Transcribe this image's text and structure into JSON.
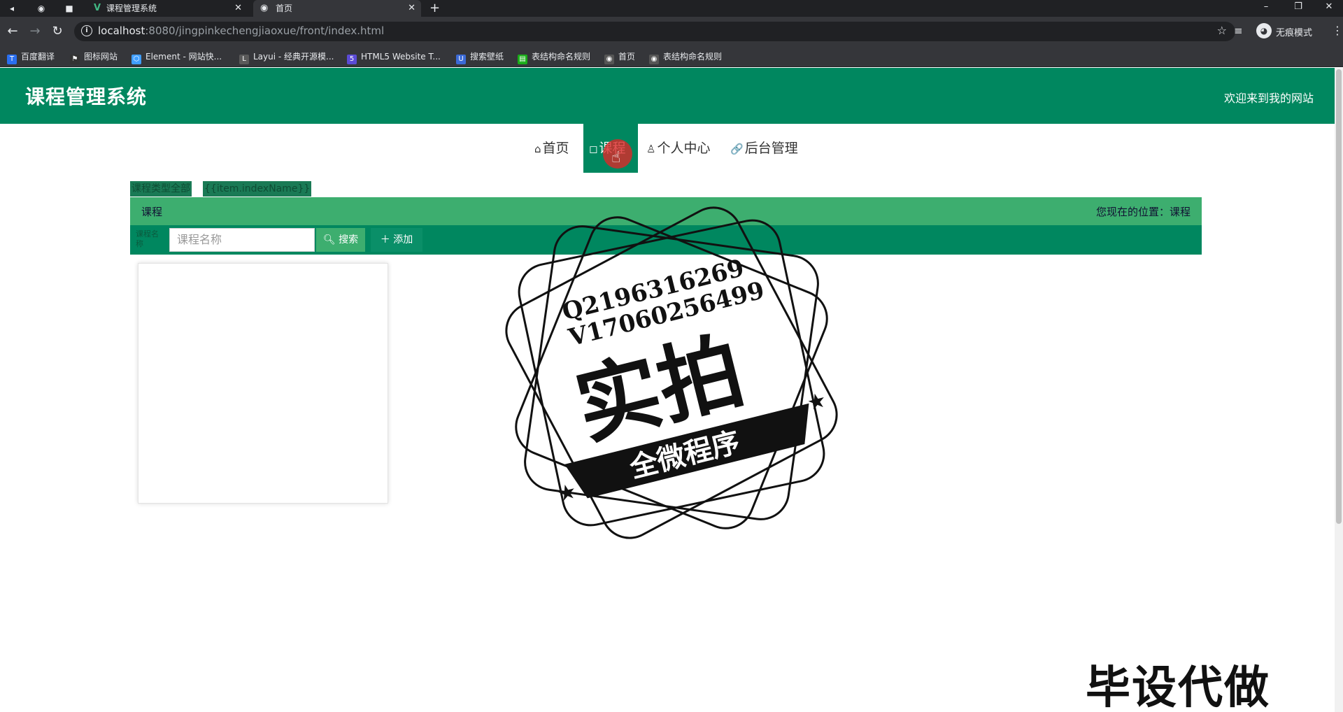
{
  "browser": {
    "tabs": [
      {
        "title": "课程管理系统",
        "active": false,
        "favicon": "vue-logo-icon"
      },
      {
        "title": "首页",
        "active": true,
        "favicon": "globe-icon"
      }
    ],
    "url_host": "localhost",
    "url_rest": ":8080/jingpinkechengjiaoxue/front/index.html",
    "profile_label": "无痕模式",
    "bookmarks": [
      {
        "label": "百度翻译",
        "color": "#2a6ff0"
      },
      {
        "label": "图标网站",
        "color": "#333333"
      },
      {
        "label": "Element - 网站快...",
        "color": "#409eff"
      },
      {
        "label": "Layui - 经典开源模...",
        "color": "#5a5a5a"
      },
      {
        "label": "HTML5 Website T...",
        "color": "#5b4bd6"
      },
      {
        "label": "搜索壁纸",
        "color": "#3b6ad6"
      },
      {
        "label": "表结构命名规则",
        "color": "#1aad19"
      },
      {
        "label": "首页",
        "color": "#555555"
      },
      {
        "label": "表结构命名规则",
        "color": "#555555"
      }
    ]
  },
  "site": {
    "title": "课程管理系统",
    "welcome": "欢迎来到我的网站"
  },
  "nav": [
    {
      "icon": "⌂",
      "label": "首页",
      "active": false
    },
    {
      "icon": "◻",
      "label": "课程",
      "active": true
    },
    {
      "icon": "♙",
      "label": "个人中心",
      "active": false
    },
    {
      "icon": "🔗",
      "label": "后台管理",
      "active": false
    }
  ],
  "type_filters": [
    "课程类型全部",
    "{{item.indexName}}"
  ],
  "breadcrumb": {
    "title": "课程",
    "location_label": "您现在的位置：",
    "location_value": "课程"
  },
  "search": {
    "field_label": "课程名称",
    "placeholder": "课程名称",
    "search_label": "搜索",
    "add_label": "添加"
  },
  "watermark": {
    "line1": "Q2196316269",
    "line2": "V17060256499",
    "big": "实拍",
    "ribbon": "全微程序",
    "corner": "毕设代做"
  },
  "colors": {
    "primary": "#00875f",
    "light_bar": "#3dae6f"
  }
}
